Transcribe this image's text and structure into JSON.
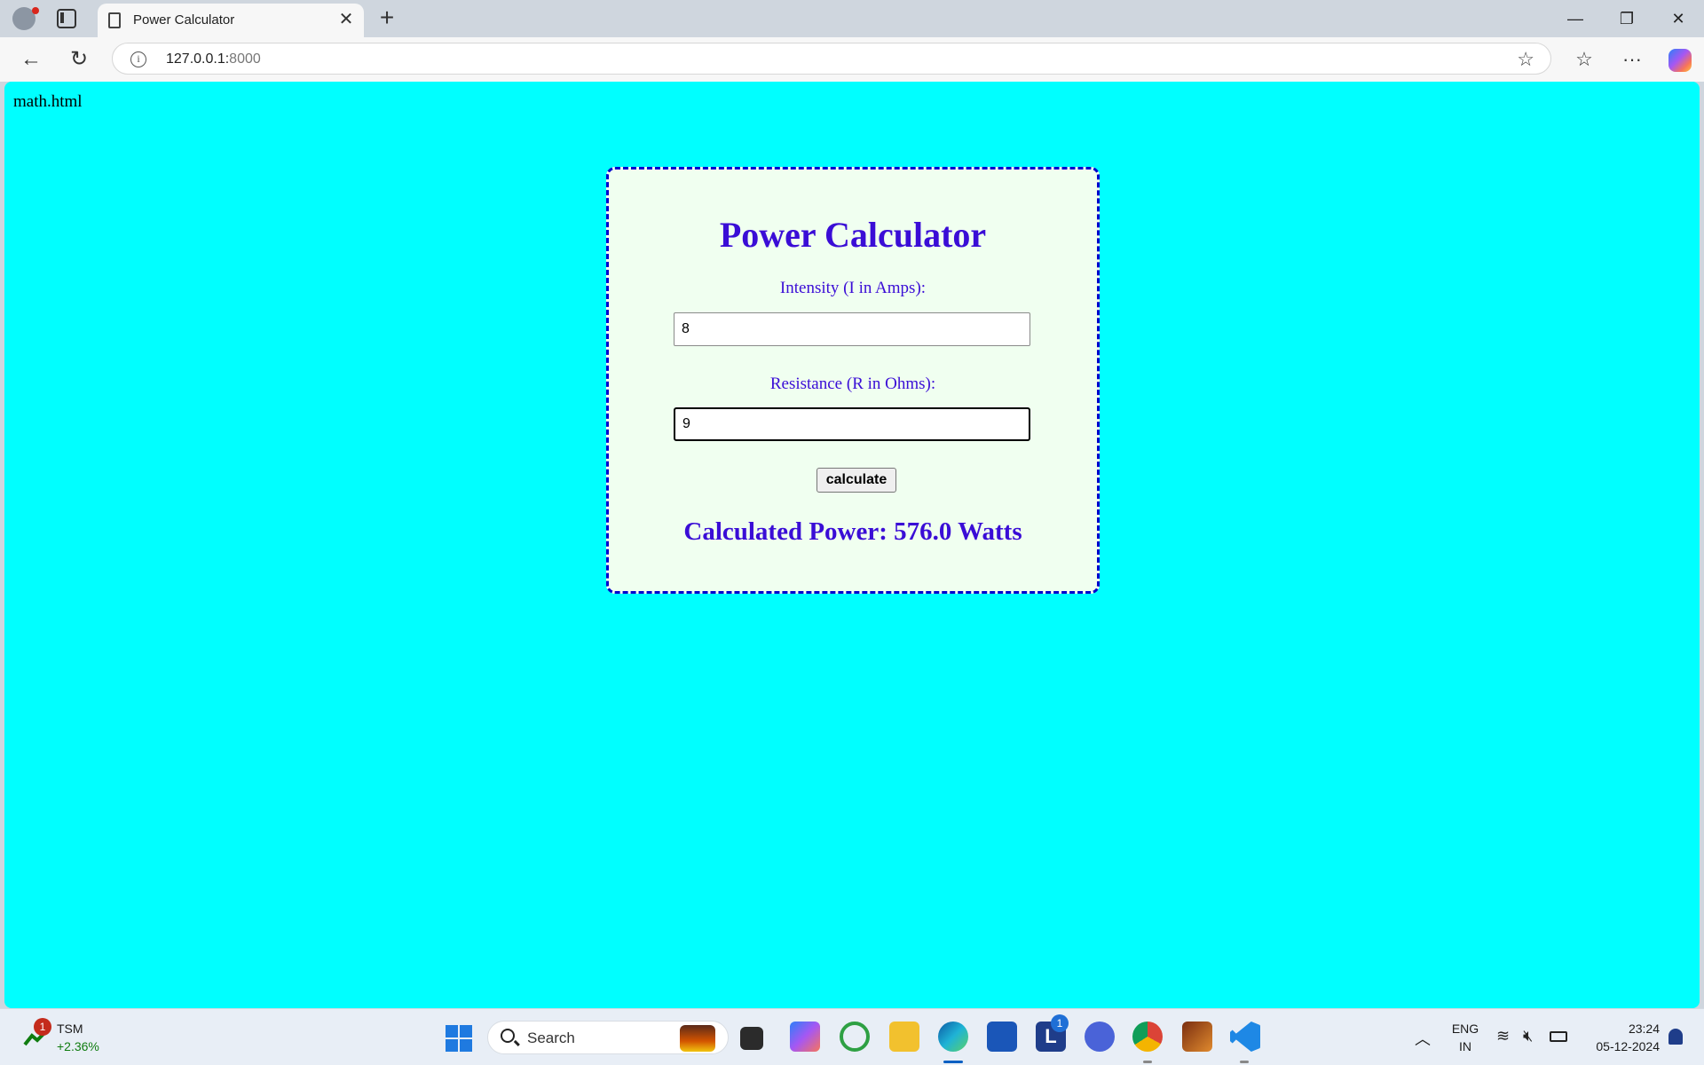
{
  "browser": {
    "tab_title": "Power Calculator",
    "url_host": "127.0.0.1:",
    "url_port": "8000"
  },
  "page": {
    "filename": "math.html",
    "title": "Power Calculator",
    "intensity_label": "Intensity (I in Amps):",
    "intensity_value": "8",
    "resistance_label": "Resistance (R in Ohms):",
    "resistance_value": "9",
    "button_label": "calculate",
    "result_text": "Calculated Power: 576.0 Watts"
  },
  "taskbar": {
    "stock_name": "TSM",
    "stock_change": "+2.36%",
    "stock_badge": "1",
    "search_label": "Search",
    "language": "ENG",
    "region": "IN",
    "time": "23:24",
    "date": "05-12-2024",
    "l_badge": "1"
  },
  "colors": {
    "page_background": "#00ffff",
    "card_background": "#f0fff0",
    "card_border": "#0000cd",
    "heading_text": "#3a0dd6"
  }
}
